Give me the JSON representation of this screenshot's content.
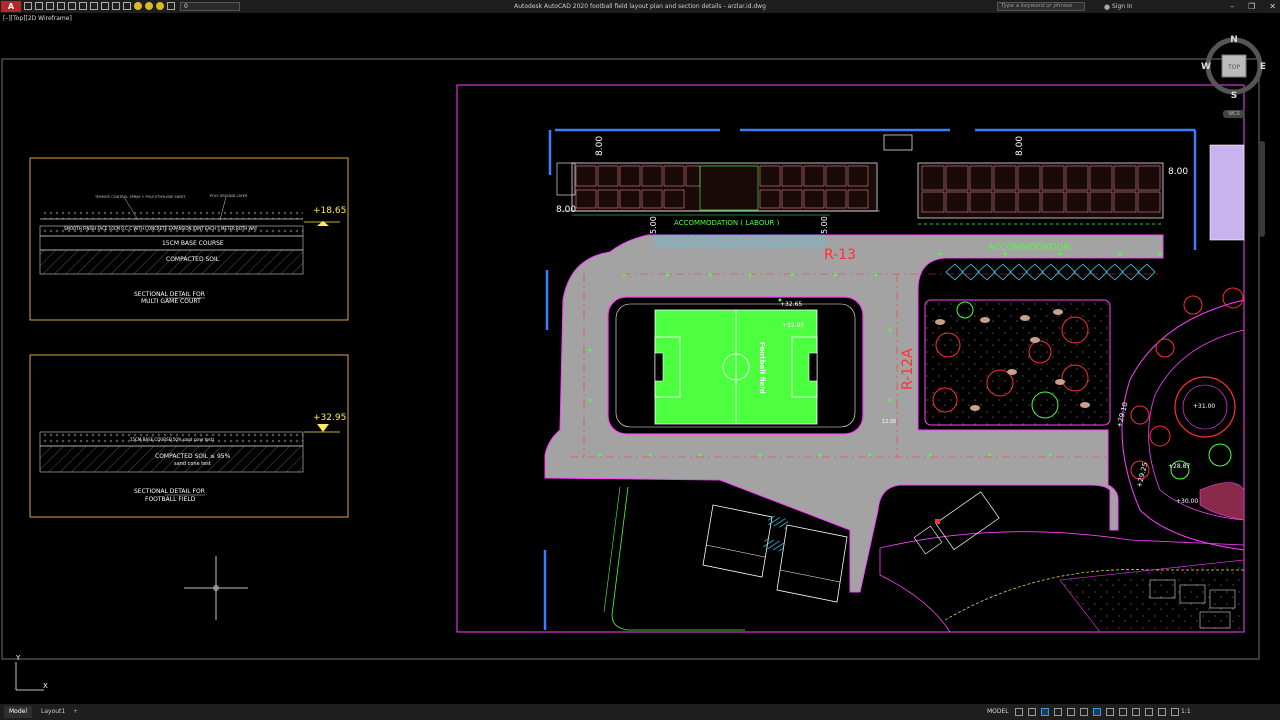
{
  "titlebar": {
    "logo": "A",
    "app_title": "Autodesk AutoCAD 2020   football field layout plan and section details - arzlar.id.dwg",
    "layer_value": "0",
    "search_placeholder": "Type a keyword or phrase",
    "signin_label": "Sign In"
  },
  "viewport": {
    "label": "[–][Top][2D Wireframe]"
  },
  "viewcube": {
    "north": "N",
    "south": "S",
    "east": "E",
    "west": "W",
    "face": "TOP",
    "wcs": "WCS"
  },
  "sections": [
    {
      "title_line1": "SECTIONAL DETAIL FOR",
      "title_line2": "MULTI GAME COURT",
      "level": "+18.65",
      "callout_left": "TERMITE CONTROL SPRAY + POLY ETHYLENE SHEET",
      "callout_right": "POLY GROUND LAYER",
      "layer_finish": "SMOOTH FINISH FACE 10CM R.C.C WITH CONCRETE EXPANSION JOINT EACH 5 METER BOTH WAY",
      "layer_base": "15CM BASE COURSE",
      "layer_soil": "COMPACTED SOIL"
    },
    {
      "title_line1": "SECTIONAL DETAIL FOR",
      "title_line2": "FOOTBALL FIELD",
      "level": "+32.95",
      "layer_base": "15CM BASE COURSE(50% sand cone test)",
      "layer_soil1": "COMPACTED SOIL ≤ 95%",
      "layer_soil2": "sand cone test"
    }
  ],
  "plan": {
    "label_accom_labour": "ACCOMMODATION  ( LABOUR )",
    "label_accom": "ACCOMMODATION",
    "road_r13": "R-13",
    "road_r12a": "R-12A",
    "football_label": "Football field",
    "level_field": "+32.95",
    "level_corner": "+32.65",
    "level_right_a": "+29.10",
    "level_right_b": "+29.25",
    "level_right_c": "+28.87",
    "level_right_d": "+31.00",
    "level_right_e": "+30.00",
    "dim_8a": "8.00",
    "dim_8b": "8.00",
    "dim_8c": "8.00",
    "dim_8d": "8.00",
    "dim_5a": "5.00",
    "dim_5b": "5.00",
    "dim_12": "12.00"
  },
  "statusbar": {
    "tab_model": "Model",
    "tab_layout": "Layout1",
    "tab_add": "+",
    "model_label": "MODEL",
    "scale": "1:1"
  },
  "colors": {
    "plot_frame": "#ff3fff",
    "field_green": "#4cff3f",
    "road_grey": "#a3a3a3",
    "section_frame": "#d9a441",
    "accent_red": "#ff3030"
  }
}
